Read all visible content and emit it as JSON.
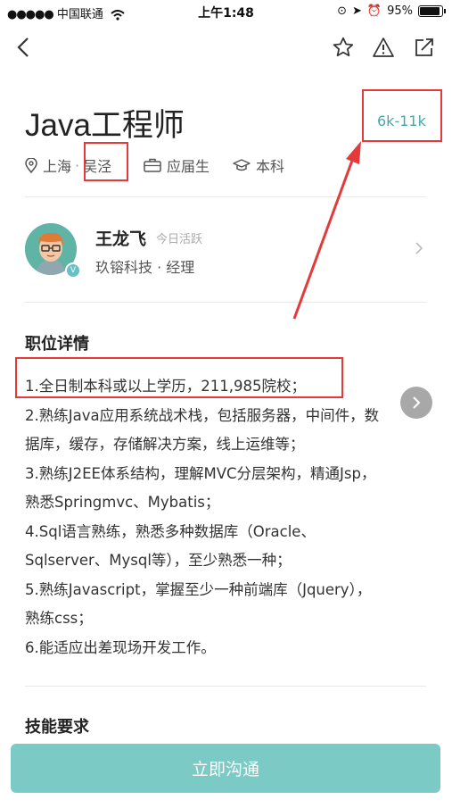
{
  "status_bar": {
    "carrier": "中国联通",
    "time": "上午1:48",
    "battery": "95%",
    "battery_level": 0.95
  },
  "job": {
    "title": "Java工程师",
    "salary": "6k-11k",
    "city": "上海",
    "separator": "·",
    "district": "吴泾",
    "experience": "应届生",
    "education": "本科"
  },
  "recruiter": {
    "name": "王龙飞",
    "activity": "今日活跃",
    "company_title": "玖镕科技 · 经理",
    "verified_badge": "V"
  },
  "details": {
    "title": "职位详情",
    "lines": [
      "1.全日制本科或以上学历，211,985院校；",
      "2.熟练Java应用系统战术栈，包括服务器，中间件，数",
      "据库，缓存，存储解决方案，线上运维等；",
      "3.熟练J2EE体系结构，理解MVC分层架构，精通Jsp，",
      "熟悉Springmvc、Mybatis；",
      "4.Sql语言熟练，熟悉多种数据库（Oracle、",
      "Sqlserver、Mysql等），至少熟悉一种；",
      "5.熟练Javascript，掌握至少一种前端库（Jquery），",
      "熟练css；",
      "6.能适应出差现场开发工作。"
    ]
  },
  "skills": {
    "title": "技能要求"
  },
  "cta": {
    "label": "立即沟通"
  },
  "colors": {
    "accent": "#4aa7a9",
    "cta": "#7ccac6",
    "annotation": "#e53a3a"
  },
  "icons": [
    "back-icon",
    "star-icon",
    "warning-icon",
    "share-icon",
    "location-icon",
    "briefcase-icon",
    "graduation-cap-icon",
    "chevron-right-icon"
  ]
}
